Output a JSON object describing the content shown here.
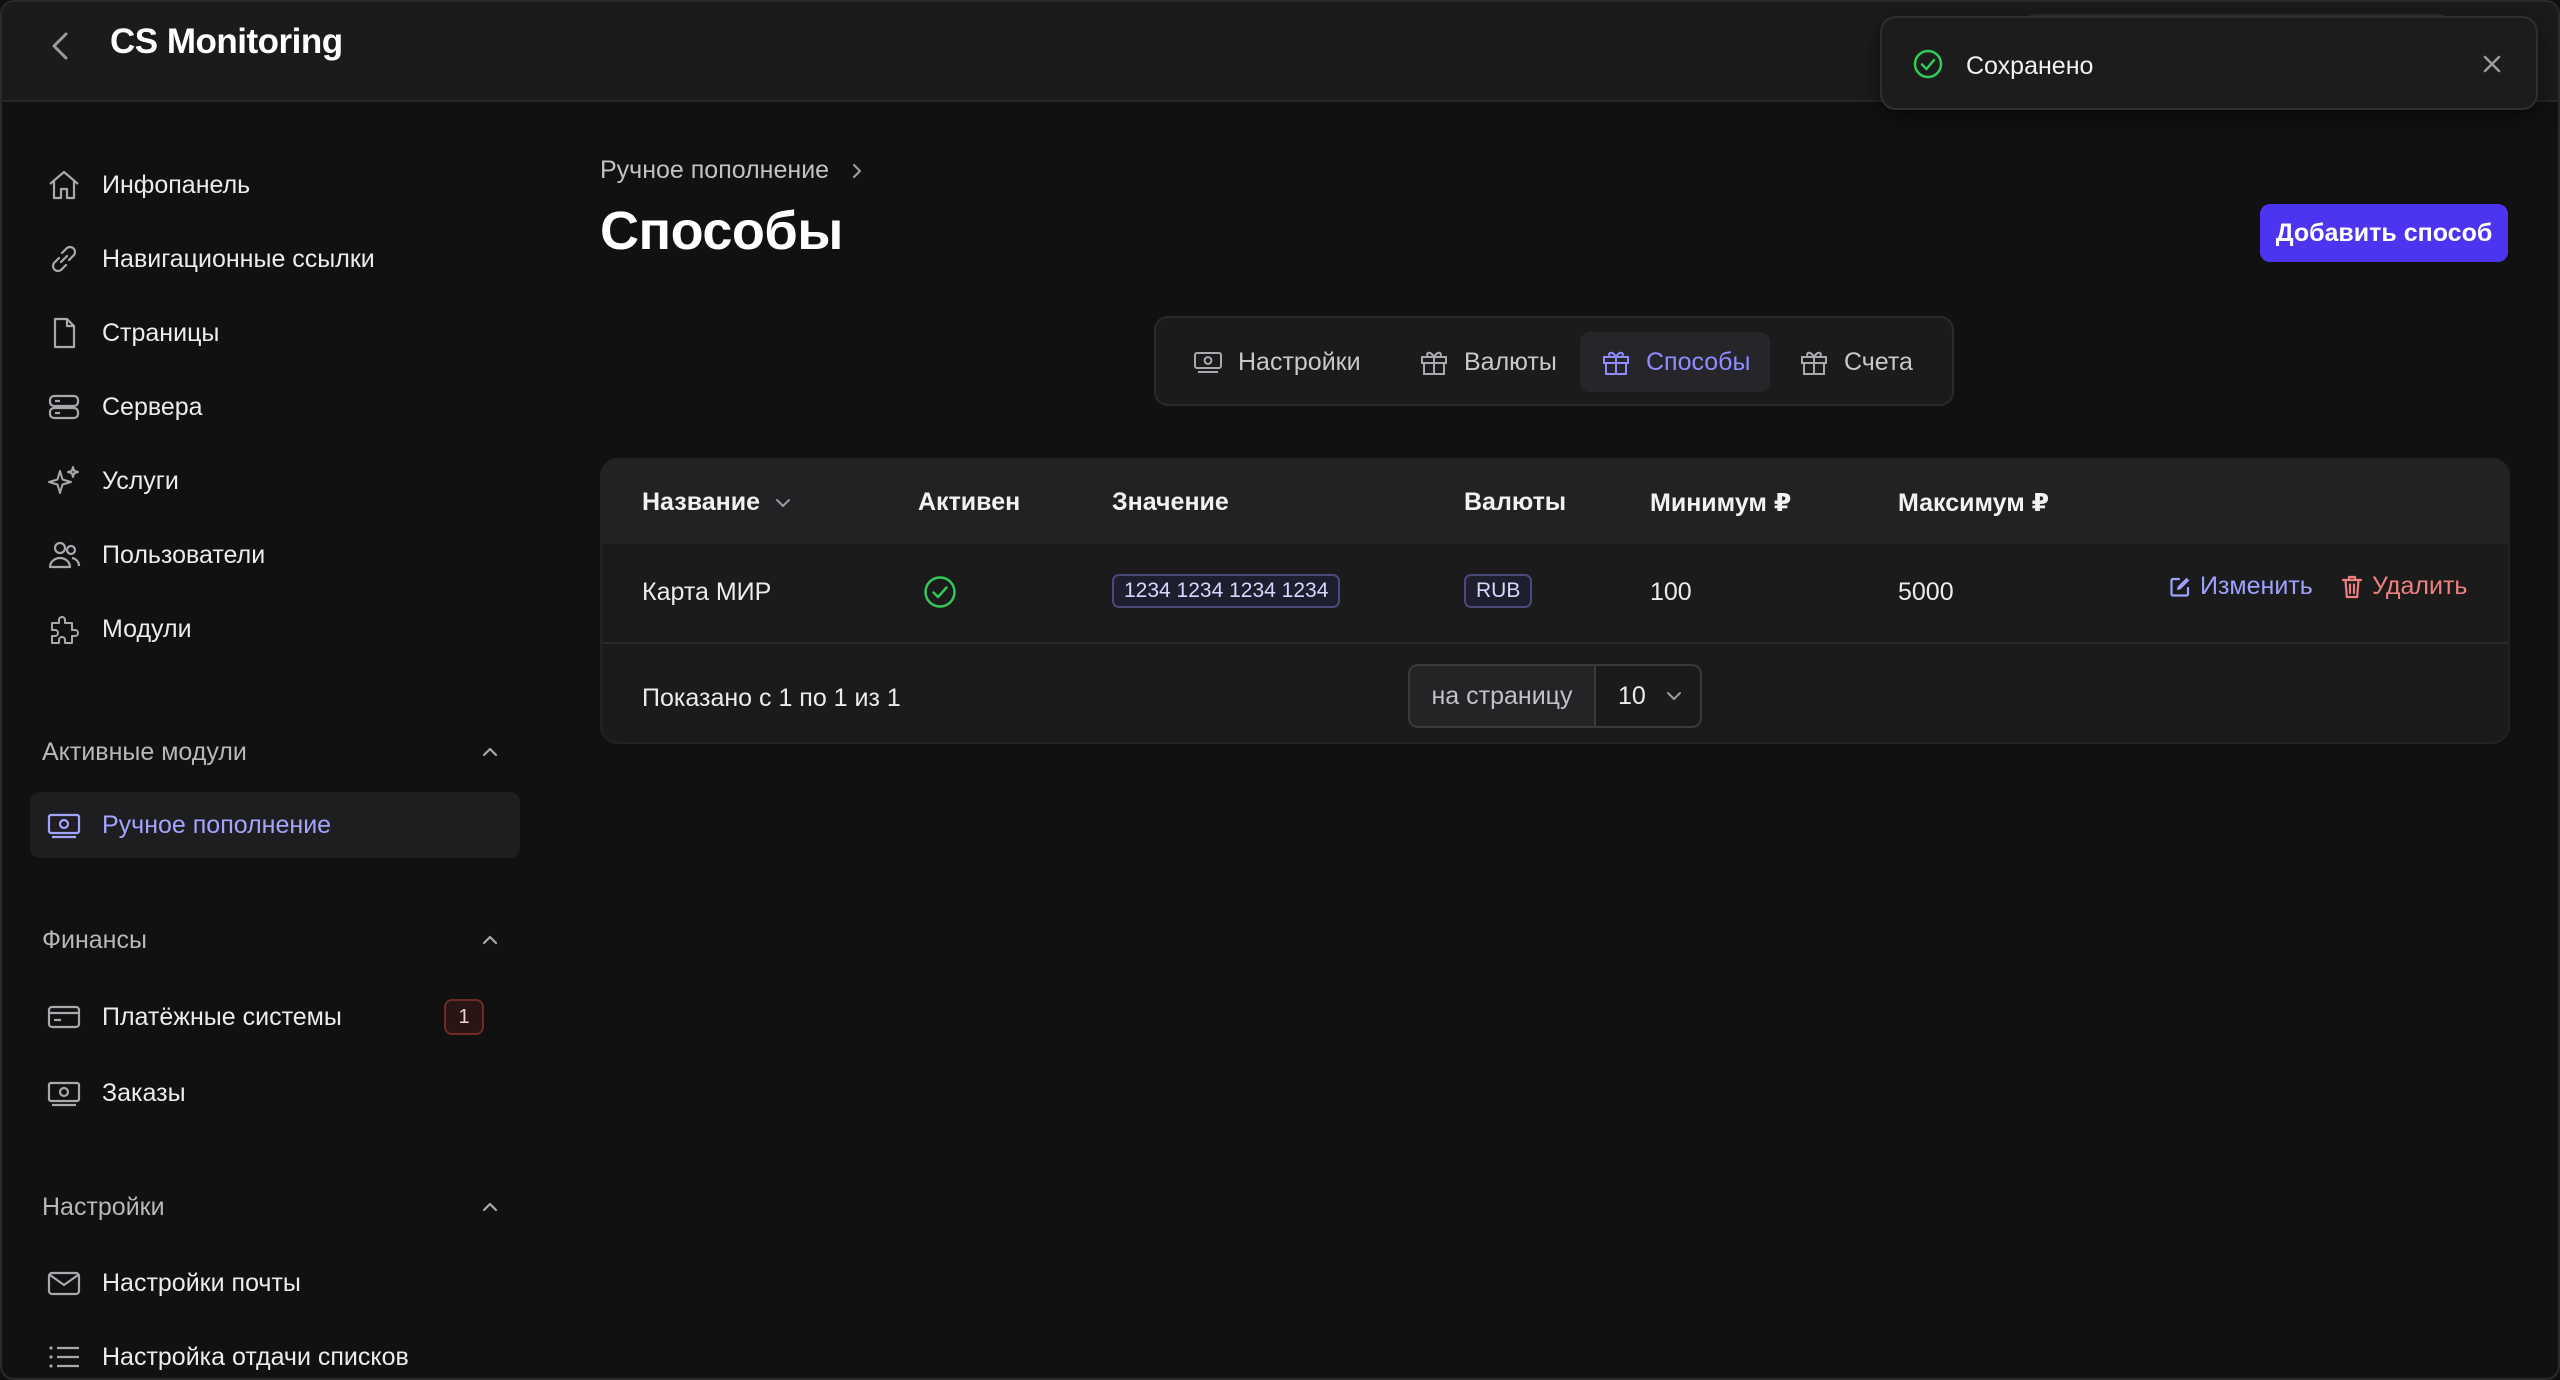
{
  "header": {
    "title": "CS Monitoring"
  },
  "toast": {
    "message": "Сохранено"
  },
  "sidebar": {
    "items": [
      {
        "label": "Инфопанель",
        "icon": "home-icon"
      },
      {
        "label": "Навигационные ссылки",
        "icon": "link-icon"
      },
      {
        "label": "Страницы",
        "icon": "document-icon"
      },
      {
        "label": "Сервера",
        "icon": "server-icon"
      },
      {
        "label": "Услуги",
        "icon": "sparkles-icon"
      },
      {
        "label": "Пользователи",
        "icon": "users-icon"
      },
      {
        "label": "Модули",
        "icon": "puzzle-icon"
      }
    ],
    "sections": [
      {
        "title": "Активные модули",
        "items": [
          {
            "label": "Ручное пополнение",
            "icon": "cash-icon",
            "active": true
          }
        ]
      },
      {
        "title": "Финансы",
        "items": [
          {
            "label": "Платёжные системы",
            "icon": "credit-card-icon",
            "badge": "1"
          },
          {
            "label": "Заказы",
            "icon": "cash-icon"
          }
        ]
      },
      {
        "title": "Настройки",
        "items": [
          {
            "label": "Настройки почты",
            "icon": "mail-icon"
          },
          {
            "label": "Настройка отдачи списков",
            "icon": "list-icon"
          }
        ]
      }
    ]
  },
  "breadcrumb": {
    "parent": "Ручное пополнение"
  },
  "page": {
    "title": "Способы",
    "add_button": "Добавить способ"
  },
  "tabs": [
    {
      "label": "Настройки",
      "icon": "cash-icon",
      "active": false
    },
    {
      "label": "Валюты",
      "icon": "gift-icon",
      "active": false
    },
    {
      "label": "Способы",
      "icon": "gift-icon",
      "active": true
    },
    {
      "label": "Счета",
      "icon": "gift-icon",
      "active": false
    }
  ],
  "table": {
    "columns": [
      "Название",
      "Активен",
      "Значение",
      "Валюты",
      "Минимум ₽",
      "Максимум ₽"
    ],
    "rows": [
      {
        "name": "Карта МИР",
        "active": true,
        "value": "1234 1234 1234 1234",
        "currency": "RUB",
        "min": "100",
        "max": "5000",
        "edit_label": "Изменить",
        "delete_label": "Удалить"
      }
    ],
    "footer": {
      "showing": "Показано с 1 по 1 из 1",
      "per_page_label": "на страницу",
      "per_page_value": "10"
    }
  },
  "colors": {
    "accent": "#4b35f0",
    "active_text": "#a4a4ff",
    "success": "#34c759",
    "danger": "#f08080"
  }
}
